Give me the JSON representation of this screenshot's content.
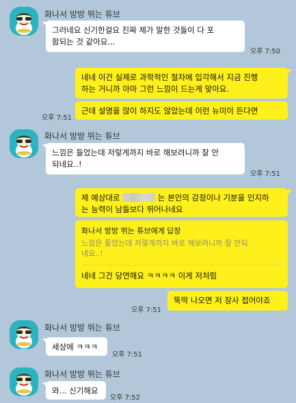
{
  "sender_name": "화나서 방방 뛰는 튜브",
  "messages": {
    "m1": {
      "lines": [
        "그러네요 신기한걸요 진짜 제가 말한 것들이 다 포",
        "함되는 것 같아요..."
      ],
      "time": "오후 7:50"
    },
    "m2": {
      "lines": [
        "네네 이건 실제로 과학적인 절차에 입각해서 지금 진행",
        "하는 거니까 아마 그런 느낌이 드는게 맞아요."
      ]
    },
    "m3": {
      "lines": [
        "근데 설명을 많이 하지도 않았는데 이런 뉴미이 든다면"
      ],
      "time": "오후 7:51"
    },
    "m4": {
      "lines": [
        "느낌은 들었는데 저렇게까지 바로 해보려니까 잘 안",
        "되네요..!"
      ],
      "time": "오후 7:51"
    },
    "m5": {
      "line1_pre": "제 예상대로",
      "line1_post": "는 본인의 감정이나 기분을 인지하",
      "line2": "는 능력이 남들보다 뛰어나네요"
    },
    "m6": {
      "reply_header": "화나서 방방 뛰는 튜브에게 답장",
      "reply_quote": [
        "느낌은 들었는데 저렇게까지 바로 해보려니까 잘 안되",
        "네요..!"
      ],
      "text": "네네 그건 당연해요 ㅋㅋㅋㅋ 이게 저처럼"
    },
    "m7": {
      "text": "뚝딱 나오면 저 장사 접어야죠",
      "time": "오후 7:51"
    },
    "m8": {
      "text": "세상에 ㅋㅋㅋ",
      "time": "오후 7:51"
    },
    "m9": {
      "text": "와... 신기해요",
      "time": "오후 7:52"
    }
  },
  "colors": {
    "background": "#b2c7d9",
    "outgoing_bubble": "#fef01b",
    "incoming_bubble": "#ffffff",
    "avatar": "#2bb3c0"
  },
  "icons": {
    "avatar": "tube-character-avatar-icon"
  }
}
